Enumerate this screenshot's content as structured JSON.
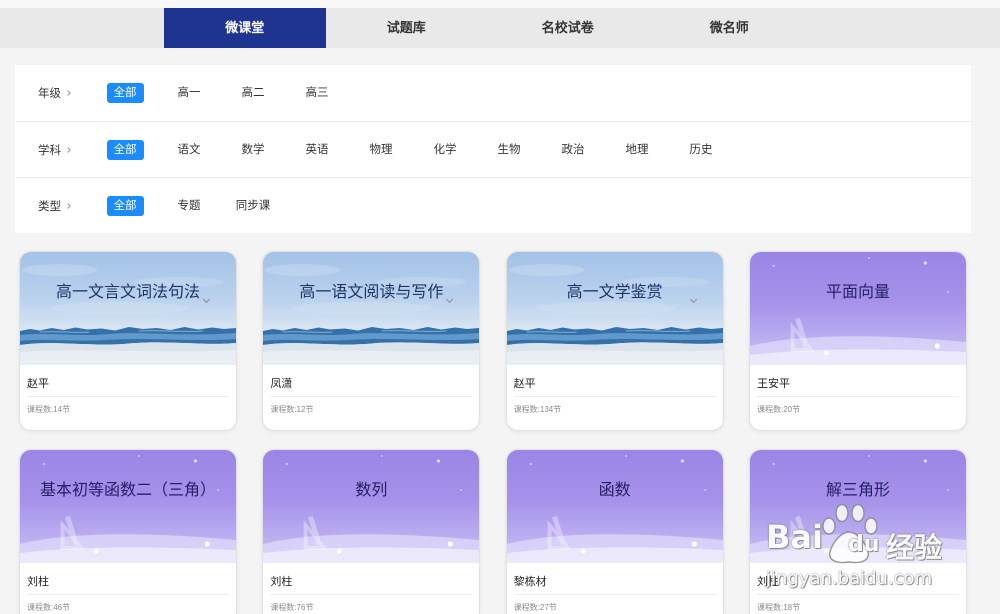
{
  "colors": {
    "nav_active_bg": "#1f3391",
    "accent": "#1a8cff"
  },
  "nav": {
    "tabs": [
      {
        "label": "微课堂",
        "active": true
      },
      {
        "label": "试题库",
        "active": false
      },
      {
        "label": "名校试卷",
        "active": false
      },
      {
        "label": "微名师",
        "active": false
      }
    ]
  },
  "filters": [
    {
      "label": "年级",
      "icon": "chevron-right-icon",
      "options": [
        {
          "label": "全部",
          "selected": true
        },
        {
          "label": "高一"
        },
        {
          "label": "高二"
        },
        {
          "label": "高三"
        }
      ]
    },
    {
      "label": "学科",
      "icon": "chevron-right-icon",
      "options": [
        {
          "label": "全部",
          "selected": true
        },
        {
          "label": "语文"
        },
        {
          "label": "数学"
        },
        {
          "label": "英语"
        },
        {
          "label": "物理"
        },
        {
          "label": "化学"
        },
        {
          "label": "生物"
        },
        {
          "label": "政治"
        },
        {
          "label": "地理"
        },
        {
          "label": "历史"
        }
      ]
    },
    {
      "label": "类型",
      "icon": "chevron-right-icon",
      "options": [
        {
          "label": "全部",
          "selected": true
        },
        {
          "label": "专题"
        },
        {
          "label": "同步课"
        }
      ]
    }
  ],
  "courses": [
    {
      "title": "高一文言文词法句法",
      "teacher": "赵平",
      "lessons": "课程数:14节"
    },
    {
      "title": "高一语文阅读与写作",
      "teacher": "凤潇",
      "lessons": "课程数:12节"
    },
    {
      "title": "高一文学鉴赏",
      "teacher": "赵平",
      "lessons": "课程数:134节"
    },
    {
      "title": "平面向量",
      "teacher": "王安平",
      "lessons": "课程数:20节"
    },
    {
      "title": "基本初等函数二（三角）",
      "teacher": "刘柱",
      "lessons": "课程数:46节"
    },
    {
      "title": "数列",
      "teacher": "刘柱",
      "lessons": "课程数:76节"
    },
    {
      "title": "函数",
      "teacher": "黎栋材",
      "lessons": "课程数:27节"
    },
    {
      "title": "解三角形",
      "teacher": "刘柱",
      "lessons": "课程数:18节"
    }
  ],
  "watermark": {
    "logo_left": "Bai",
    "logo_right": "du",
    "product": "经验",
    "url": "jingyan.baidu.com",
    "icon": "baidu-paw-icon"
  }
}
